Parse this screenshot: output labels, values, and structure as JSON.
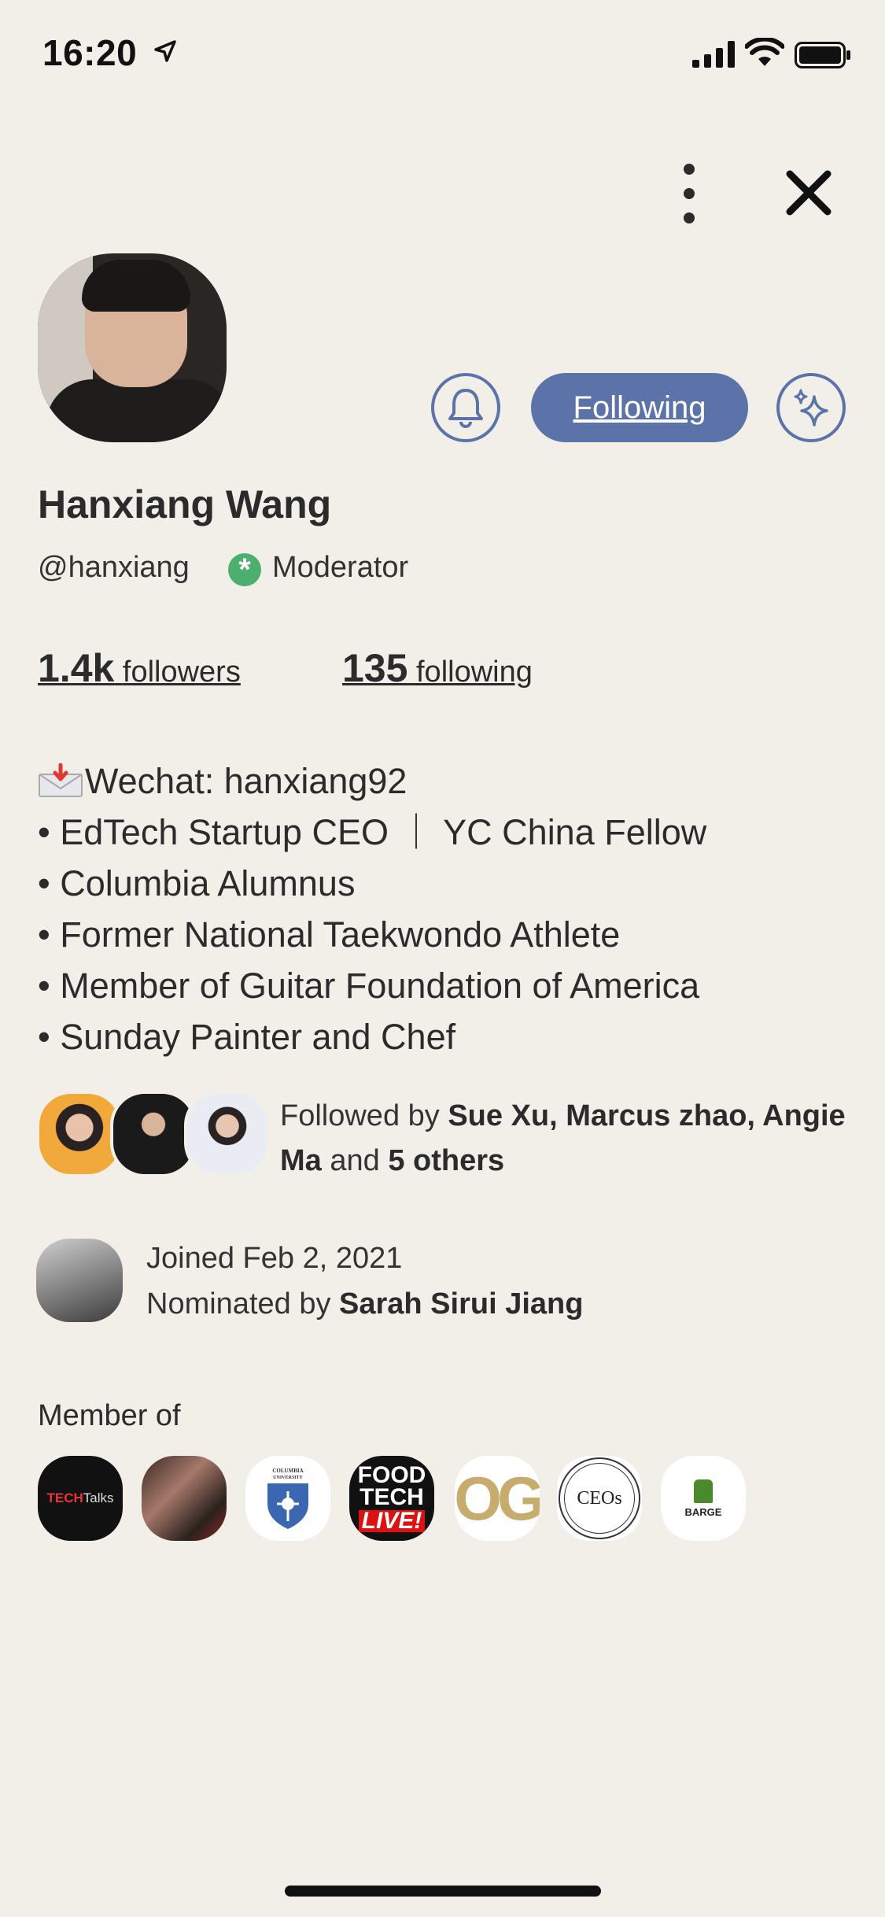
{
  "status_bar": {
    "time": "16:20"
  },
  "profile": {
    "name": "Hanxiang Wang",
    "handle": "@hanxiang",
    "role_label": "Moderator",
    "follow_button": "Following",
    "followers_count": "1.4k",
    "followers_label": "followers",
    "following_count": "135",
    "following_label": "following"
  },
  "bio": {
    "wechat": "Wechat: hanxiang92",
    "lines": [
      "• EdTech Startup CEO ｜ YC China Fellow",
      "• Columbia Alumnus",
      "• Former National Taekwondo Athlete",
      "• Member of Guitar Foundation of America",
      "• Sunday Painter and Chef"
    ]
  },
  "followed_by": {
    "prefix": "Followed by ",
    "names": "Sue Xu, Marcus zhao, Angie Ma",
    "and": " and ",
    "others": "5 others"
  },
  "joined": {
    "date_text": "Joined Feb 2, 2021",
    "nominated_prefix": "Nominated by ",
    "nominator": "Sarah Sirui Jiang"
  },
  "clubs": {
    "heading": "Member of",
    "items": [
      {
        "name": "TECH Talks",
        "text_a": "TECH",
        "text_b": "Talks"
      },
      {
        "name": "fight-club"
      },
      {
        "name": "Columbia University",
        "text_a": "COLUMBIA",
        "text_b": "UNIVERSITY"
      },
      {
        "name": "FOOD TECH LIVE!",
        "text_a": "FOOD",
        "text_b": "TECH",
        "text_c": "LIVE!"
      },
      {
        "name": "OG",
        "text_a": "OG"
      },
      {
        "name": "CEOs",
        "text_a": "CEOs"
      },
      {
        "name": "BARGE",
        "text_a": "BARGE"
      }
    ]
  },
  "colors": {
    "background": "#f1efe8",
    "accent": "#5b73a8",
    "moderator_green": "#4caf6e"
  }
}
